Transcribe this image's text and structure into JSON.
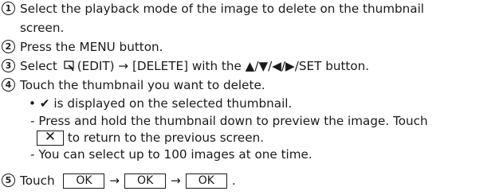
{
  "steps": [
    {
      "num": "1",
      "line1": "Select the playback mode of the image to delete on the thumbnail",
      "line2": "screen."
    },
    {
      "num": "2",
      "text": "Press the MENU button."
    },
    {
      "num": "3",
      "pre": "Select",
      "icon": "edit-icon",
      "post": "(EDIT) → [DELETE] with the ▲/▼/◀/▶/SET button."
    },
    {
      "num": "4",
      "text": "Touch the thumbnail you want to delete."
    },
    {
      "num": "5",
      "pre": "Touch",
      "ok": "OK",
      "arrow": "→",
      "end": "."
    }
  ],
  "notes": {
    "bullet": "•",
    "check": "✔",
    "check_text": "is displayed on the selected thumbnail.",
    "dash": "-",
    "preview_line1": "Press and hold the thumbnail down to preview the image. Touch",
    "close_symbol": "✕",
    "preview_line2": "to return to the previous screen.",
    "limit": "You can select up to 100 images at one time."
  }
}
